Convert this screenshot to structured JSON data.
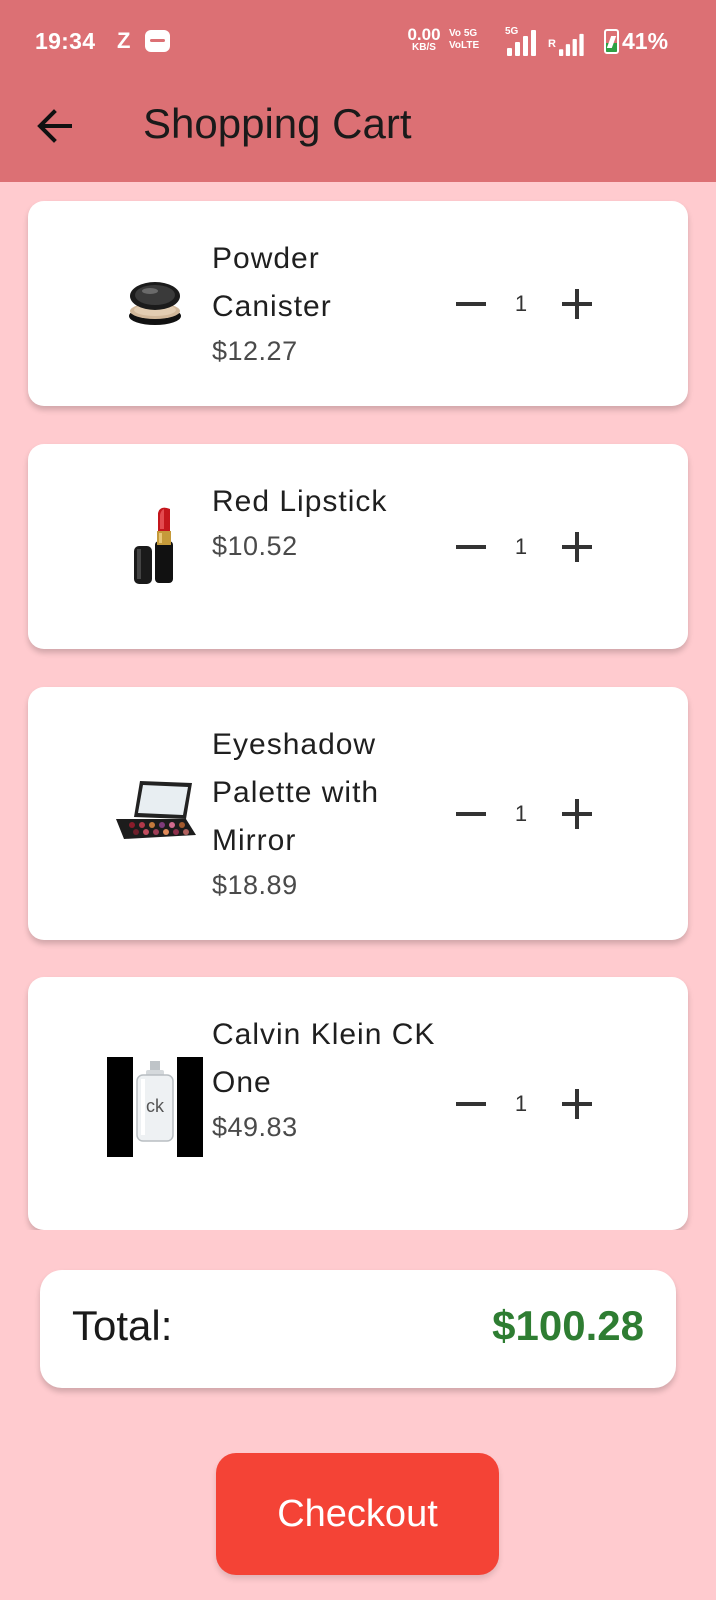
{
  "status_bar": {
    "time": "19:34",
    "notification_letter": "Z",
    "net_speed_value": "0.00",
    "net_speed_unit": "KB/S",
    "volte_label": "Vo 5G\nVoLTE",
    "network_label": "5G",
    "roaming_label": "R",
    "battery_percent": "41%",
    "battery_level": 0.41,
    "battery_charging": true
  },
  "header": {
    "title": "Shopping Cart",
    "back_icon": "arrow-left-icon"
  },
  "cart": {
    "items": [
      {
        "name": "Powder Canister",
        "price": "$12.27",
        "quantity": "1",
        "image": "powder-canister-image"
      },
      {
        "name": "Red Lipstick",
        "price": "$10.52",
        "quantity": "1",
        "image": "red-lipstick-image"
      },
      {
        "name": "Eyeshadow Palette with Mirror",
        "price": "$18.89",
        "quantity": "1",
        "image": "eyeshadow-palette-image"
      },
      {
        "name": "Calvin Klein CK One",
        "price": "$49.83",
        "quantity": "1",
        "image": "ck-one-perfume-image"
      }
    ],
    "decrement_icon": "minus-icon",
    "increment_icon": "plus-icon"
  },
  "summary": {
    "total_label": "Total:",
    "total_value": "$100.28"
  },
  "actions": {
    "checkout_label": "Checkout"
  },
  "colors": {
    "app_bar": "#dc7074",
    "background": "#ffcbcf",
    "card": "#ffffff",
    "total_value": "#2e7d32",
    "checkout_button": "#f44336",
    "battery_fill": "#2ea043"
  }
}
